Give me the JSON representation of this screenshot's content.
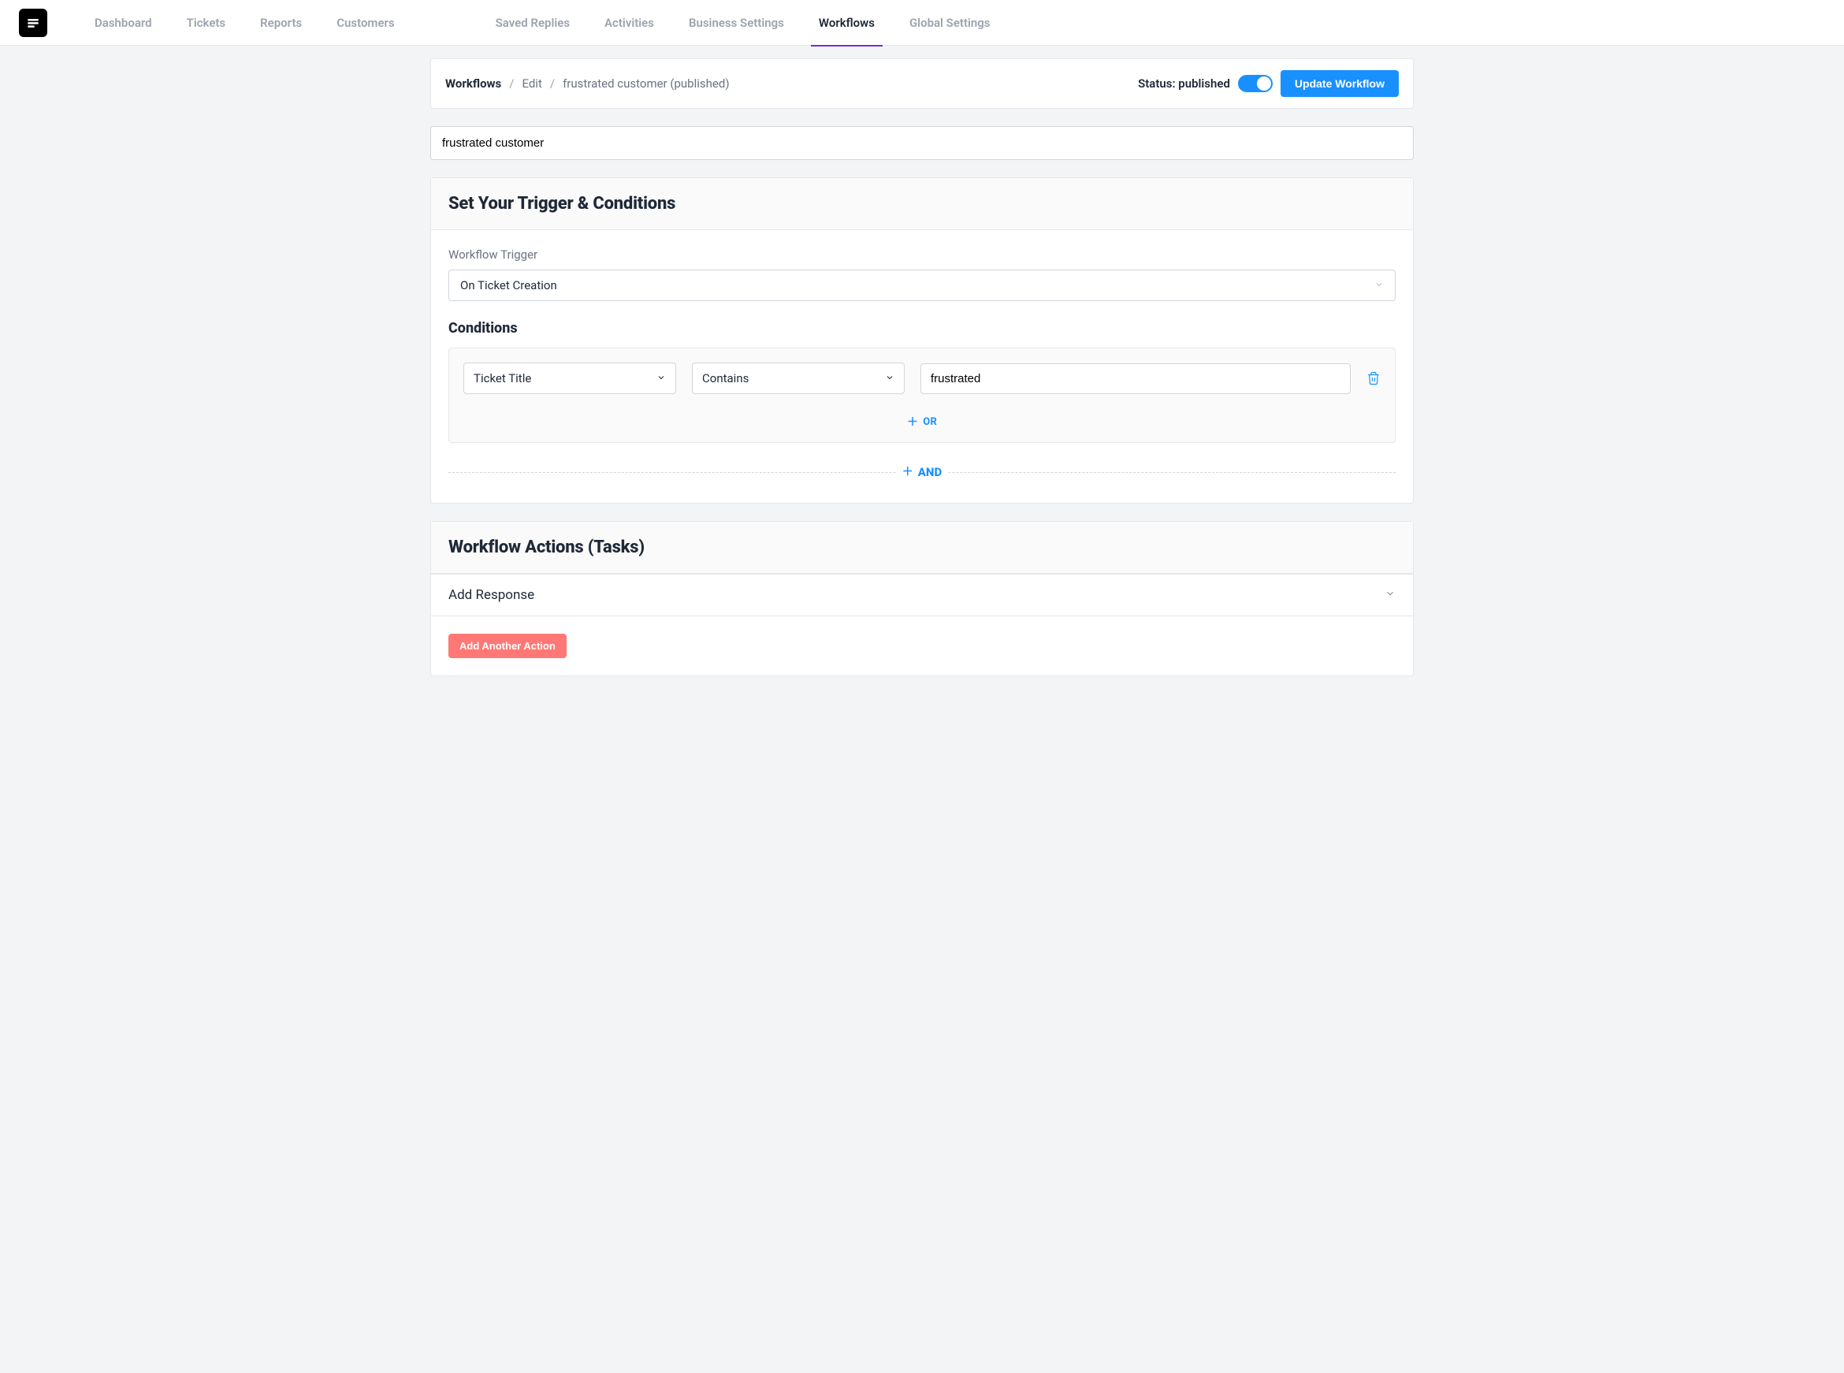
{
  "nav": {
    "items": [
      {
        "label": "Dashboard",
        "active": false
      },
      {
        "label": "Tickets",
        "active": false
      },
      {
        "label": "Reports",
        "active": false
      },
      {
        "label": "Customers",
        "active": false
      },
      {
        "label": "Saved Replies",
        "active": false
      },
      {
        "label": "Activities",
        "active": false
      },
      {
        "label": "Business Settings",
        "active": false
      },
      {
        "label": "Workflows",
        "active": true
      },
      {
        "label": "Global Settings",
        "active": false
      }
    ]
  },
  "breadcrumb": {
    "root": "Workflows",
    "edit": "Edit",
    "name": "frustrated customer (published)"
  },
  "header": {
    "status_label": "Status: published",
    "update_btn": "Update Workflow"
  },
  "title": {
    "value": "frustrated customer"
  },
  "triggers": {
    "heading": "Set Your Trigger & Conditions",
    "trigger_label": "Workflow Trigger",
    "trigger_value": "On Ticket Creation",
    "conditions_heading": "Conditions",
    "condition": {
      "field": "Ticket Title",
      "operator": "Contains",
      "value": "frustrated"
    },
    "or_label": "OR",
    "and_label": "AND"
  },
  "actions": {
    "heading": "Workflow Actions (Tasks)",
    "item_label": "Add Response",
    "add_btn": "Add Another Action"
  }
}
